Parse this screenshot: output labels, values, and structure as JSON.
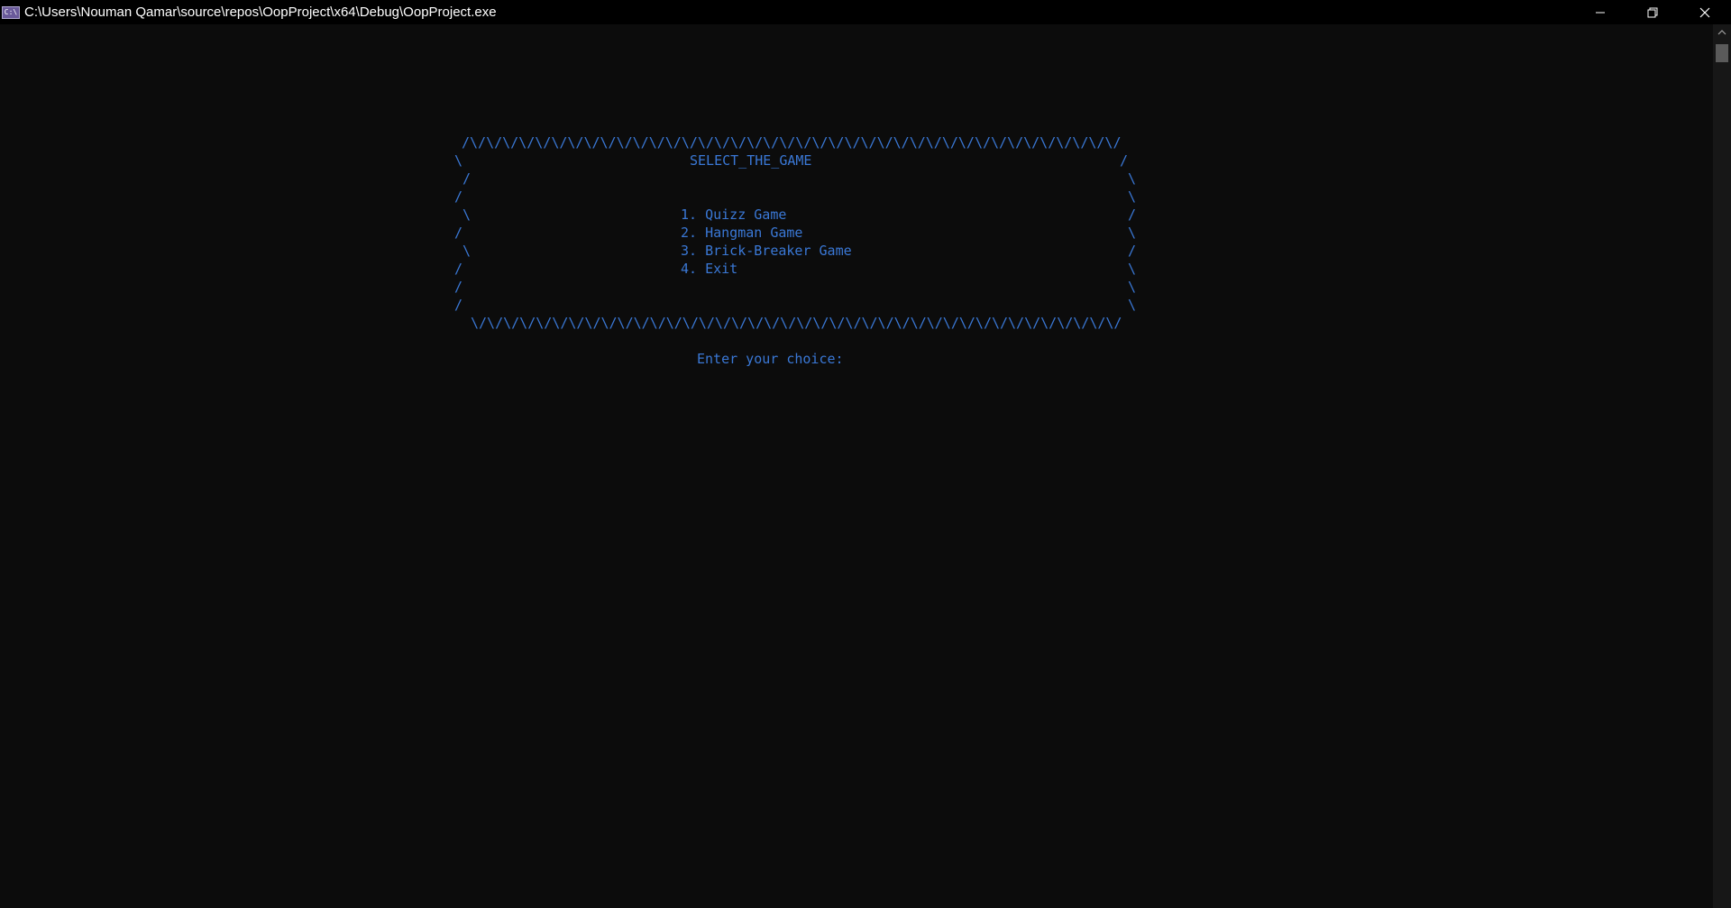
{
  "window": {
    "title": "C:\\Users\\Nouman Qamar\\source\\repos\\OopProject\\x64\\Debug\\OopProject.exe",
    "icon": "console-app-icon",
    "icon_text": "C:\\",
    "controls": [
      "minimize-icon",
      "restore-icon",
      "close-icon"
    ]
  },
  "console": {
    "text_color": "#3a78d6",
    "background": "#0c0c0c",
    "border_top": "/\\/\\/\\/\\/\\/\\/\\/\\/\\/\\/\\/\\/\\/\\/\\/\\/\\/\\/\\/\\/\\/\\/\\/\\/\\/\\/\\/\\/\\/\\/\\/\\/\\/\\/\\/\\/\\/\\/\\/\\/",
    "border_bottom": "\\/\\/\\/\\/\\/\\/\\/\\/\\/\\/\\/\\/\\/\\/\\/\\/\\/\\/\\/\\/\\/\\/\\/\\/\\/\\/\\/\\/\\/\\/\\/\\/\\/\\/\\/\\/\\/\\/\\/\\/",
    "heading": "SELECT_THE_GAME",
    "rows": [
      {
        "left": "\\",
        "right": "/"
      },
      {
        "left": " /",
        "right": "\\"
      },
      {
        "left": "/",
        "right": "\\"
      },
      {
        "left": " \\",
        "right": "/"
      },
      {
        "left": "/",
        "right": "\\"
      },
      {
        "left": " \\",
        "right": "/"
      },
      {
        "left": "/",
        "right": "\\"
      },
      {
        "left": "/",
        "right": "\\"
      },
      {
        "left": "/",
        "right": "\\"
      }
    ],
    "menu": [
      "1. Quizz Game",
      "2. Hangman Game",
      "3. Brick-Breaker Game",
      "4. Exit"
    ],
    "prompt": "Enter your choice:"
  }
}
